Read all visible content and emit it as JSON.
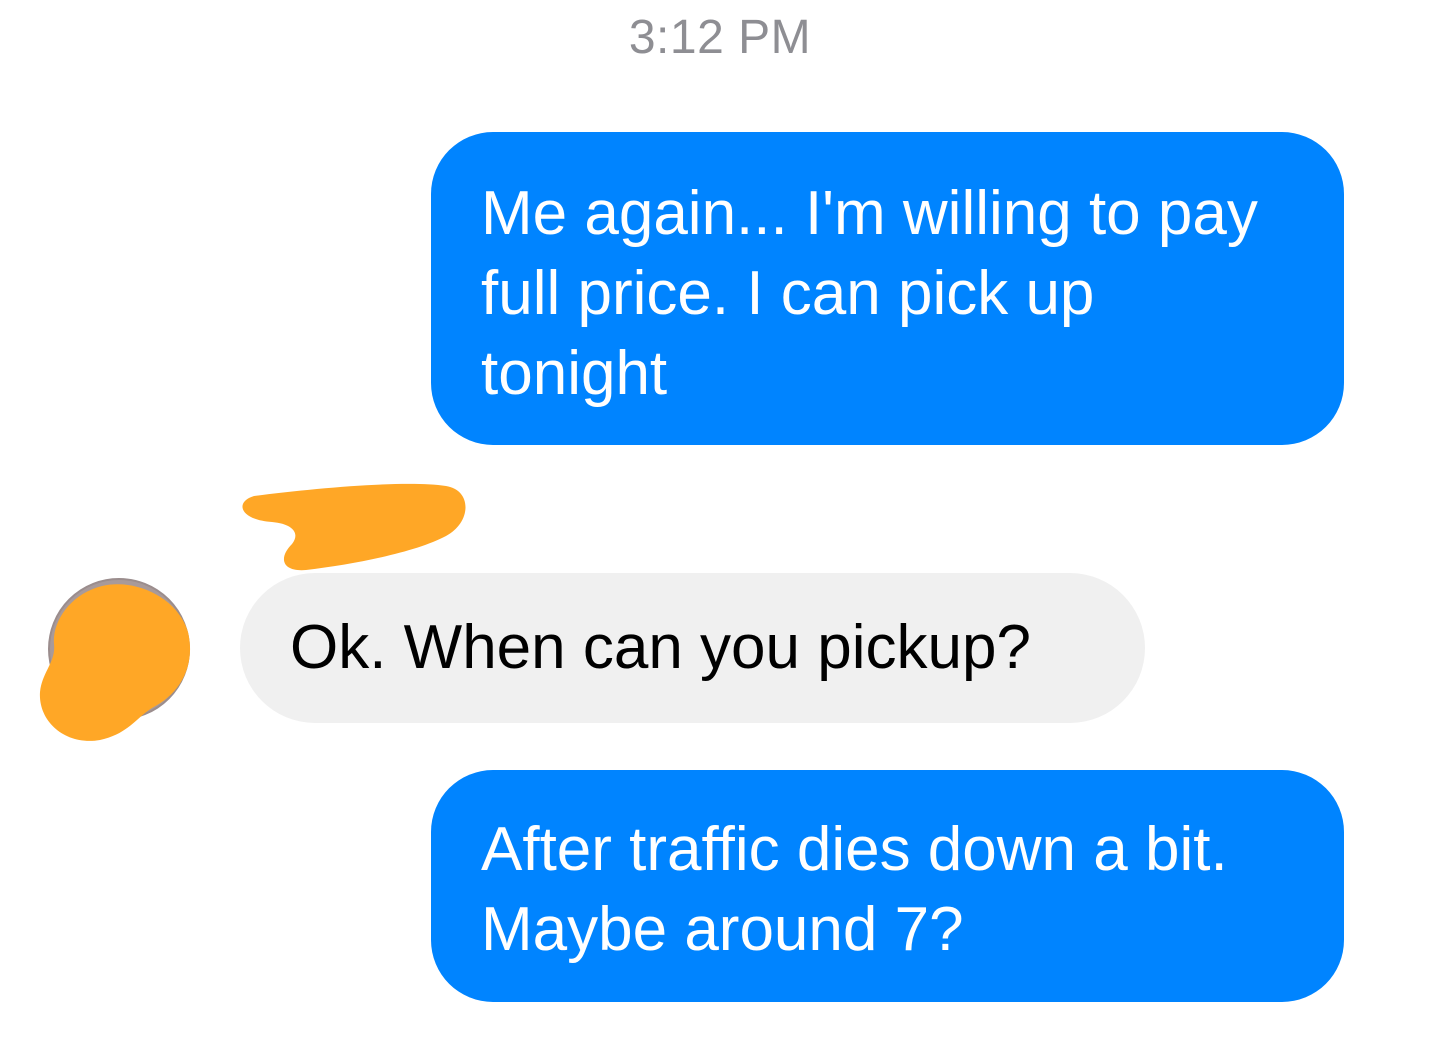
{
  "conversation": {
    "timestamp": "3:12 PM",
    "messages": [
      {
        "direction": "outgoing",
        "text": "Me again... I'm willing to pay full price. I can pick up tonight"
      },
      {
        "direction": "incoming",
        "text": "Ok. When can you pickup?"
      },
      {
        "direction": "outgoing",
        "text": "After traffic dies down a bit.  Maybe around 7?"
      }
    ]
  },
  "colors": {
    "outgoing_bubble": "#0084ff",
    "incoming_bubble": "#f0f0f0",
    "redaction": "#ffa726",
    "timestamp_text": "#8e8e93"
  }
}
